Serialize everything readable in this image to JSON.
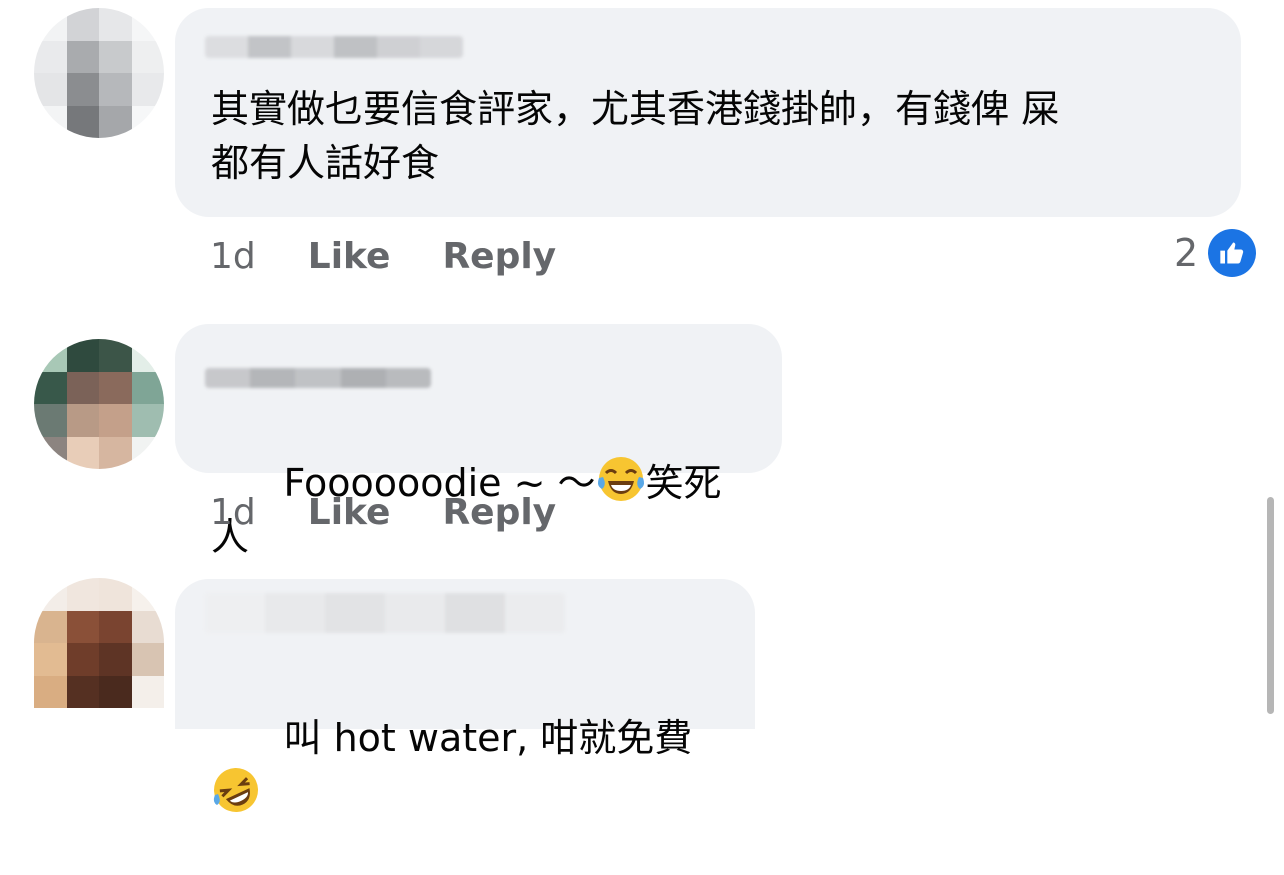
{
  "comments": [
    {
      "text": "其實做乜要信食評家，尤其香港錢掛帥，有錢俾 屎\n都有人話好食",
      "time": "1d",
      "like_label": "Like",
      "reply_label": "Reply",
      "reaction_count": "2",
      "reaction_icon": "thumbs-up-icon"
    },
    {
      "text_before_emoji": "Foooooodie ~ ～",
      "emoji": "face-with-tears-of-joy",
      "text_after_emoji": "笑死人",
      "time": "1d",
      "like_label": "Like",
      "reply_label": "Reply"
    },
    {
      "text": "叫 hot water, 咁就免費",
      "emoji": "rolling-on-the-floor-laughing"
    }
  ],
  "colors": {
    "bubble": "#f0f2f5",
    "meta_text": "#65676b",
    "like_badge": "#1b74e4"
  }
}
